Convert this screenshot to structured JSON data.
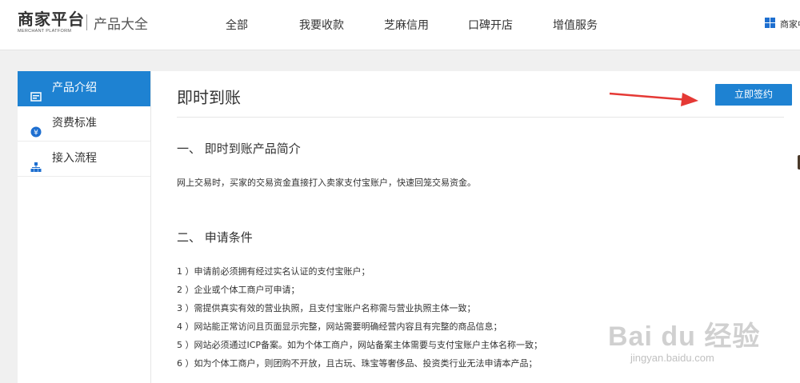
{
  "header": {
    "logo_main": "商家平台",
    "logo_sub": "MERCHANT PLATFORM",
    "section": "产品大全",
    "nav": [
      "全部",
      "我要收款",
      "芝麻信用",
      "口碑开店",
      "增值服务"
    ],
    "right_label": "商家中"
  },
  "sidebar": {
    "items": [
      {
        "label": "产品介绍",
        "icon": "card-icon",
        "active": true
      },
      {
        "label": "资费标准",
        "icon": "yen-icon",
        "active": false
      },
      {
        "label": "接入流程",
        "icon": "flow-chart-icon",
        "active": false
      }
    ]
  },
  "main": {
    "title": "即时到账",
    "sign_button": "立即签约",
    "section1_heading": "一、 即时到账产品简介",
    "section1_text": "网上交易时，买家的交易资金直接打入卖家支付宝账户，快速回笼交易资金。",
    "section2_heading": "二、 申请条件",
    "requirements": [
      "1 ）申请前必须拥有经过实名认证的支付宝账户；",
      "2 ）企业或个体工商户可申请；",
      "3 ）需提供真实有效的营业执照，且支付宝账户名称需与营业执照主体一致；",
      "4 ）网站能正常访问且页面显示完整，网站需要明确经营内容且有完整的商品信息；",
      "5 ）网站必须通过ICP备案。如为个体工商户，网站备案主体需要与支付宝账户主体名称一致；",
      "6 ）如为个体工商户，则团购不开放，且古玩、珠宝等奢侈品、投资类行业无法申请本产品；"
    ]
  },
  "watermark": {
    "text": "Bai du 经验",
    "url": "jingyan.baidu.com"
  },
  "colors": {
    "accent": "#1e82d2",
    "arrow": "#e53935"
  }
}
